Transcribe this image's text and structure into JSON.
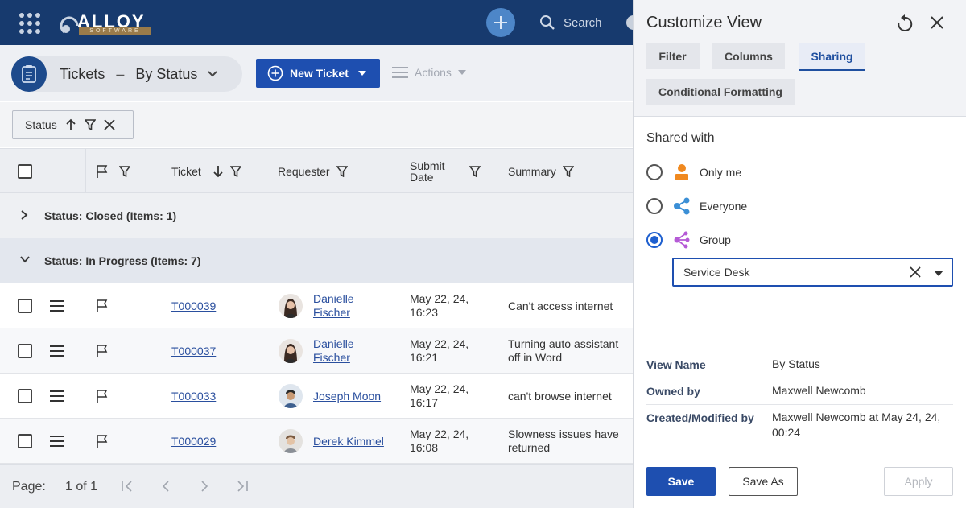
{
  "topbar": {
    "logo_text": "ALLOY",
    "logo_sub": "SOFTWARE",
    "search_label": "Search"
  },
  "page": {
    "title": "Tickets",
    "separator": "–",
    "view": "By Status",
    "new_ticket": "New Ticket",
    "actions": "Actions"
  },
  "filter_chip": {
    "label": "Status"
  },
  "grid": {
    "columns": {
      "ticket": "Ticket",
      "requester": "Requester",
      "submit_date_line1": "Submit",
      "submit_date_line2": "Date",
      "summary": "Summary"
    },
    "groups": [
      {
        "label": "Status: Closed (Items: 1)"
      },
      {
        "label": "Status: In Progress (Items: 7)"
      }
    ],
    "rows": [
      {
        "ticket": "T000039",
        "requester_first": "Danielle",
        "requester_last": "Fischer",
        "date_line1": "May 22, 24,",
        "date_line2": "16:23",
        "summary_line1": "Can't access internet",
        "summary_line2": ""
      },
      {
        "ticket": "T000037",
        "requester_first": "Danielle",
        "requester_last": "Fischer",
        "date_line1": "May 22, 24,",
        "date_line2": "16:21",
        "summary_line1": "Turning auto assistant",
        "summary_line2": "off in Word"
      },
      {
        "ticket": "T000033",
        "requester_first": "Joseph Moon",
        "requester_last": "",
        "date_line1": "May 22, 24,",
        "date_line2": "16:17",
        "summary_line1": "can't browse internet",
        "summary_line2": ""
      },
      {
        "ticket": "T000029",
        "requester_first": "Derek Kimmel",
        "requester_last": "",
        "date_line1": "May 22, 24,",
        "date_line2": "16:08",
        "summary_line1": "Slowness issues have",
        "summary_line2": "returned"
      }
    ]
  },
  "pager": {
    "label": "Page:",
    "value": "1 of 1"
  },
  "panel": {
    "title": "Customize View",
    "tabs": [
      "Filter",
      "Columns",
      "Sharing",
      "Conditional Formatting"
    ],
    "active_tab": "Sharing",
    "shared_with_label": "Shared with",
    "options": [
      {
        "label": "Only me",
        "selected": false,
        "icon": "person-icon",
        "color": "#f0891f"
      },
      {
        "label": "Everyone",
        "selected": false,
        "icon": "share-icon",
        "color": "#3b8fd6"
      },
      {
        "label": "Group",
        "selected": true,
        "icon": "group-share-icon",
        "color": "#b55ad6"
      }
    ],
    "group_value": "Service Desk",
    "info": [
      {
        "key": "View Name",
        "value": "By Status",
        "value2": ""
      },
      {
        "key": "Owned by",
        "value": "Maxwell Newcomb",
        "value2": ""
      },
      {
        "key": "Created/Modified by",
        "value": "Maxwell Newcomb at May 24, 24,",
        "value2": "00:24"
      }
    ],
    "buttons": {
      "save": "Save",
      "save_as": "Save As",
      "apply": "Apply"
    }
  },
  "colors": {
    "topbar": "#173a6e",
    "accent": "#1e4fb0",
    "link": "#2a4f9e"
  }
}
